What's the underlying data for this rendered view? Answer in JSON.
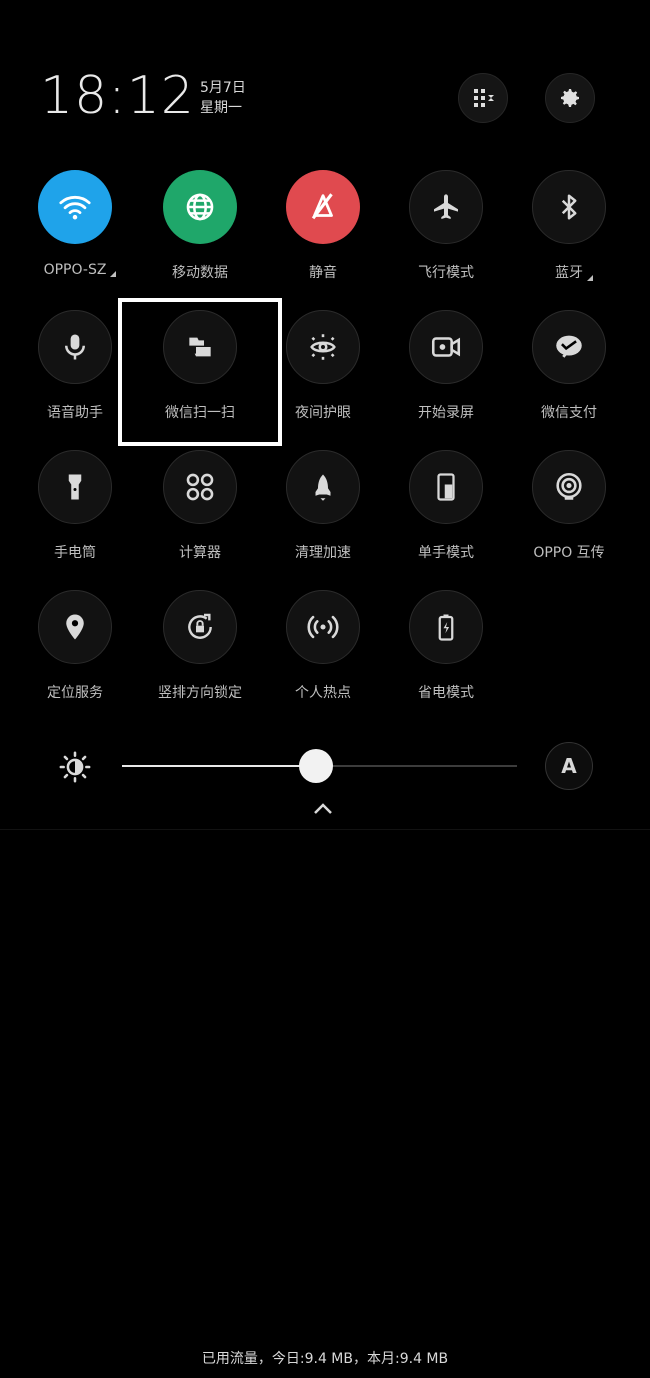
{
  "header": {
    "time": "18:12",
    "date": "5月7日",
    "weekday": "星期一"
  },
  "tiles": [
    {
      "label": "OPPO-SZ",
      "icon": "wifi-icon",
      "active": true
    },
    {
      "label": "移动数据",
      "icon": "mobile-data-icon",
      "active": true
    },
    {
      "label": "静音",
      "icon": "silent-icon",
      "active": true
    },
    {
      "label": "飞行模式",
      "icon": "airplane-icon",
      "active": false
    },
    {
      "label": "蓝牙",
      "icon": "bluetooth-icon",
      "active": false
    },
    {
      "label": "语音助手",
      "icon": "microphone-icon",
      "active": false
    },
    {
      "label": "微信扫一扫",
      "icon": "wechat-scan-icon",
      "active": false
    },
    {
      "label": "夜间护眼",
      "icon": "eye-icon",
      "active": false
    },
    {
      "label": "开始录屏",
      "icon": "screen-record-icon",
      "active": false
    },
    {
      "label": "微信支付",
      "icon": "wechat-pay-icon",
      "active": false
    },
    {
      "label": "手电筒",
      "icon": "flashlight-icon",
      "active": false
    },
    {
      "label": "计算器",
      "icon": "calculator-icon",
      "active": false
    },
    {
      "label": "清理加速",
      "icon": "rocket-icon",
      "active": false
    },
    {
      "label": "单手模式",
      "icon": "one-hand-icon",
      "active": false
    },
    {
      "label": "OPPO 互传",
      "icon": "share-icon",
      "active": false
    },
    {
      "label": "定位服务",
      "icon": "location-icon",
      "active": false
    },
    {
      "label": "竖排方向锁定",
      "icon": "rotation-lock-icon",
      "active": false
    },
    {
      "label": "个人热点",
      "icon": "hotspot-icon",
      "active": false
    },
    {
      "label": "省电模式",
      "icon": "battery-saver-icon",
      "active": false
    }
  ],
  "brightness": {
    "level": 0.49,
    "auto_label": "A"
  },
  "footer": {
    "usage_text": "已用流量，今日:9.4 MB，本月:9.4 MB"
  },
  "colors": {
    "wifi": "#1fa3ea",
    "mobile_data": "#1fa76a",
    "silent": "#e04a4f",
    "background": "#000000"
  }
}
